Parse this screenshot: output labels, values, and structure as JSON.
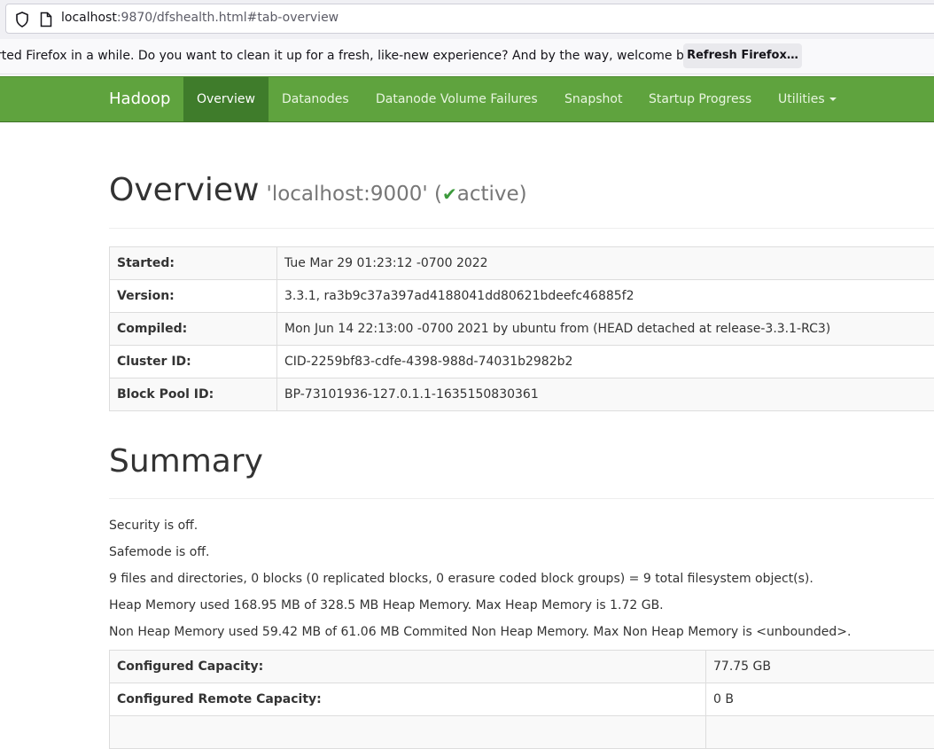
{
  "browser": {
    "url_host": "localhost",
    "url_rest": ":9870/dfshealth.html#tab-overview",
    "notice_text": "rted Firefox in a while. Do you want to clean it up for a fresh, like-new experience? And by the way, welcome back!",
    "notice_button": "Refresh Firefox…"
  },
  "navbar": {
    "brand": "Hadoop",
    "items": [
      {
        "label": "Overview",
        "active": true
      },
      {
        "label": "Datanodes",
        "active": false
      },
      {
        "label": "Datanode Volume Failures",
        "active": false
      },
      {
        "label": "Snapshot",
        "active": false
      },
      {
        "label": "Startup Progress",
        "active": false
      },
      {
        "label": "Utilities",
        "active": false
      }
    ]
  },
  "overview": {
    "title": "Overview",
    "host": "'localhost:9000' (",
    "check": "✔",
    "state": "active)",
    "rows": [
      {
        "key": "Started:",
        "value": "Tue Mar 29 01:23:12 -0700 2022"
      },
      {
        "key": "Version:",
        "value": "3.3.1, ra3b9c37a397ad4188041dd80621bdeefc46885f2"
      },
      {
        "key": "Compiled:",
        "value": "Mon Jun 14 22:13:00 -0700 2021 by ubuntu from (HEAD detached at release-3.3.1-RC3)"
      },
      {
        "key": "Cluster ID:",
        "value": "CID-2259bf83-cdfe-4398-988d-74031b2982b2"
      },
      {
        "key": "Block Pool ID:",
        "value": "BP-73101936-127.0.1.1-1635150830361"
      }
    ]
  },
  "summary": {
    "title": "Summary",
    "lines": [
      "Security is off.",
      "Safemode is off.",
      "9 files and directories, 0 blocks (0 replicated blocks, 0 erasure coded block groups) = 9 total filesystem object(s).",
      "Heap Memory used 168.95 MB of 328.5 MB Heap Memory. Max Heap Memory is 1.72 GB.",
      "Non Heap Memory used 59.42 MB of 61.06 MB Commited Non Heap Memory. Max Non Heap Memory is <unbounded>."
    ],
    "rows": [
      {
        "key": "Configured Capacity:",
        "value": "77.75 GB"
      },
      {
        "key": "Configured Remote Capacity:",
        "value": "0 B"
      },
      {
        "key": "",
        "value": ""
      }
    ]
  }
}
